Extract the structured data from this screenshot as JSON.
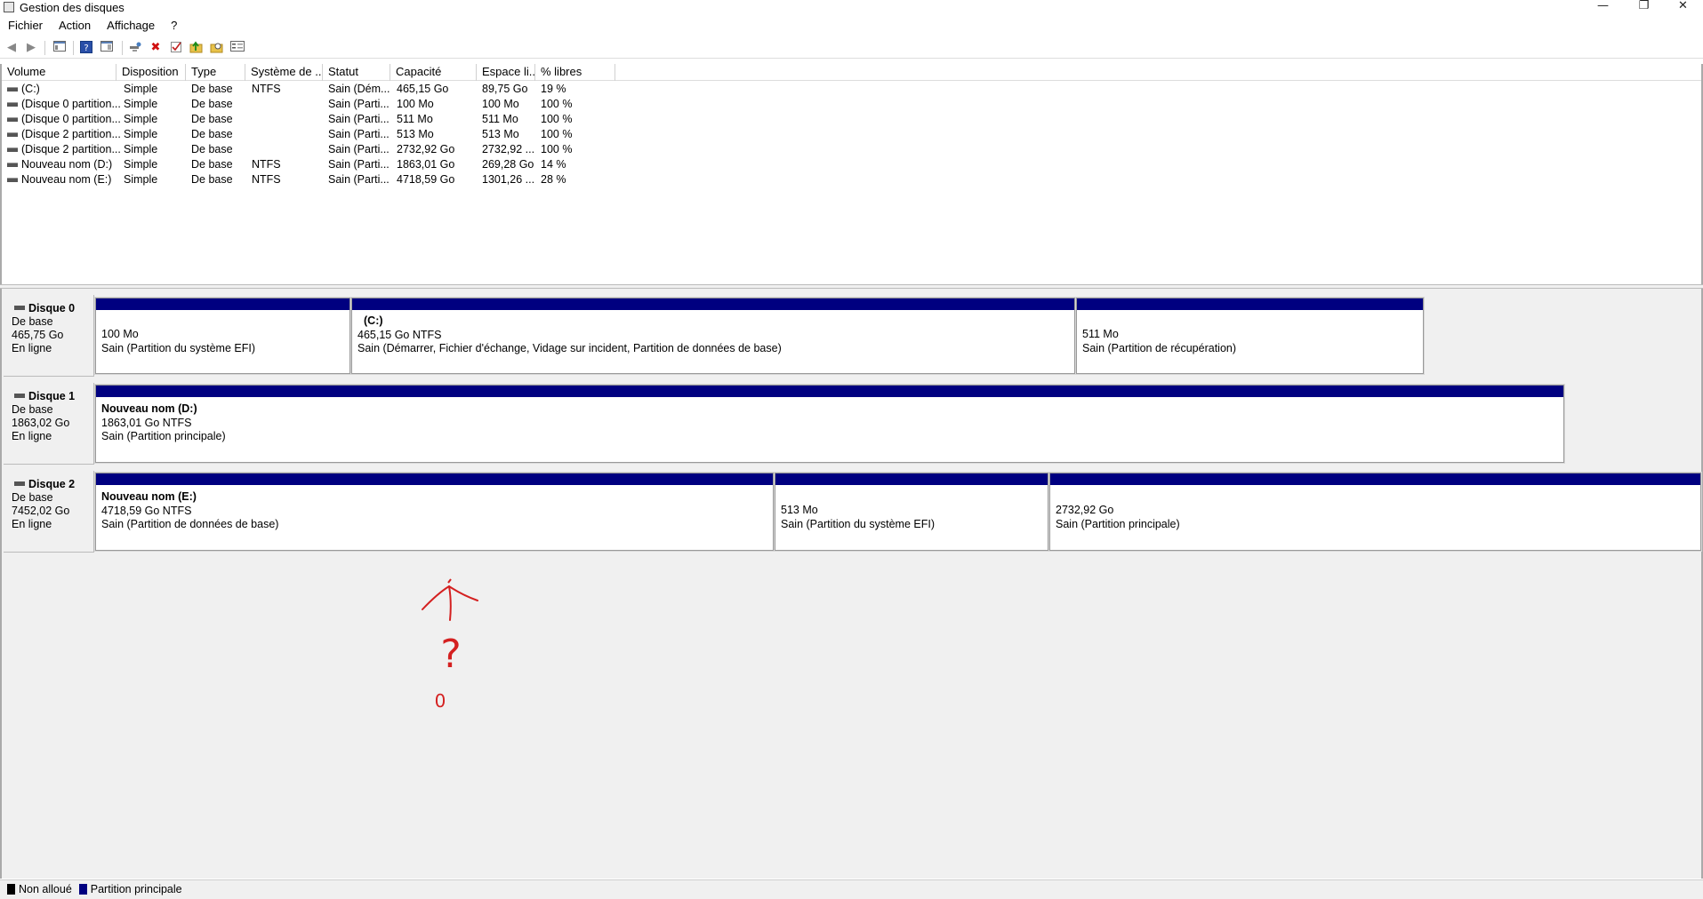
{
  "window": {
    "title": "Gestion des disques",
    "minimize": "—",
    "restore": "❐",
    "close": "✕"
  },
  "menu": [
    "Fichier",
    "Action",
    "Affichage",
    "?"
  ],
  "toolbar": {
    "icons": [
      "back-arrow-icon",
      "forward-arrow-icon",
      "console-tree-icon",
      "help-icon",
      "properties-icon",
      "connect-icon",
      "delete-icon",
      "check-icon",
      "up-folder-icon",
      "search-folder-icon",
      "details-icon"
    ]
  },
  "columns": [
    "Volume",
    "Disposition",
    "Type",
    "Système de ...",
    "Statut",
    "Capacité",
    "Espace li...",
    "% libres"
  ],
  "volumes": [
    {
      "volume": "(C:)",
      "disposition": "Simple",
      "type": "De base",
      "fs": "NTFS",
      "statut": "Sain (Dém...",
      "capacite": "465,15 Go",
      "espace": "89,75 Go",
      "pct": "19 %"
    },
    {
      "volume": "(Disque 0 partition...",
      "disposition": "Simple",
      "type": "De base",
      "fs": "",
      "statut": "Sain (Parti...",
      "capacite": "100 Mo",
      "espace": "100 Mo",
      "pct": "100 %"
    },
    {
      "volume": "(Disque 0 partition...",
      "disposition": "Simple",
      "type": "De base",
      "fs": "",
      "statut": "Sain (Parti...",
      "capacite": "511 Mo",
      "espace": "511 Mo",
      "pct": "100 %"
    },
    {
      "volume": "(Disque 2 partition...",
      "disposition": "Simple",
      "type": "De base",
      "fs": "",
      "statut": "Sain (Parti...",
      "capacite": "513 Mo",
      "espace": "513 Mo",
      "pct": "100 %"
    },
    {
      "volume": "(Disque 2 partition...",
      "disposition": "Simple",
      "type": "De base",
      "fs": "",
      "statut": "Sain (Parti...",
      "capacite": "2732,92 Go",
      "espace": "2732,92 ...",
      "pct": "100 %"
    },
    {
      "volume": "Nouveau nom (D:)",
      "disposition": "Simple",
      "type": "De base",
      "fs": "NTFS",
      "statut": "Sain (Parti...",
      "capacite": "1863,01 Go",
      "espace": "269,28 Go",
      "pct": "14 %"
    },
    {
      "volume": "Nouveau nom (E:)",
      "disposition": "Simple",
      "type": "De base",
      "fs": "NTFS",
      "statut": "Sain (Parti...",
      "capacite": "4718,59 Go",
      "espace": "1301,26 ...",
      "pct": "28 %"
    }
  ],
  "disks": [
    {
      "name": "Disque 0",
      "kind": "De base",
      "size": "465,75 Go",
      "state": "En ligne",
      "partitions": [
        {
          "name": "",
          "size": "100 Mo",
          "status": "Sain (Partition du système EFI)"
        },
        {
          "name": "(C:)",
          "size": "465,15 Go NTFS",
          "status": "Sain (Démarrer, Fichier d'échange, Vidage sur incident, Partition de données de base)"
        },
        {
          "name": "",
          "size": "511 Mo",
          "status": "Sain (Partition de récupération)"
        }
      ]
    },
    {
      "name": "Disque 1",
      "kind": "De base",
      "size": "1863,02 Go",
      "state": "En ligne",
      "partitions": [
        {
          "name": "Nouveau nom  (D:)",
          "size": "1863,01 Go NTFS",
          "status": "Sain (Partition principale)"
        }
      ]
    },
    {
      "name": "Disque 2",
      "kind": "De base",
      "size": "7452,02 Go",
      "state": "En ligne",
      "partitions": [
        {
          "name": "Nouveau nom  (E:)",
          "size": "4718,59 Go NTFS",
          "status": "Sain (Partition de données de base)"
        },
        {
          "name": "",
          "size": "513 Mo",
          "status": "Sain (Partition du système EFI)"
        },
        {
          "name": "",
          "size": "2732,92 Go",
          "status": "Sain (Partition principale)"
        }
      ]
    }
  ],
  "legend": [
    {
      "label": "Non alloué",
      "color": "#000000"
    },
    {
      "label": "Partition principale",
      "color": "#000080"
    }
  ],
  "annotation": {
    "question_mark": "?",
    "zero": "0",
    "color": "#d42020"
  }
}
